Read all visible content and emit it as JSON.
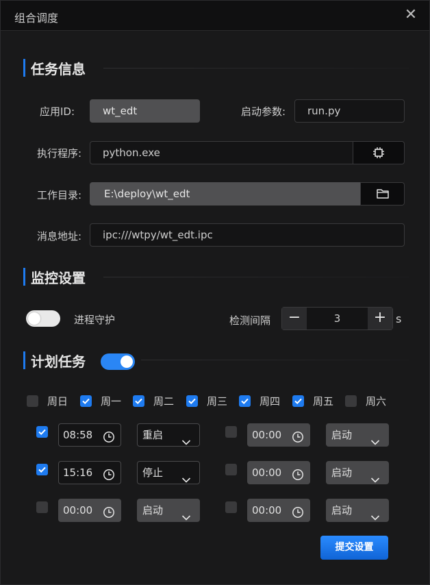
{
  "window": {
    "title": "组合调度",
    "close_icon": "close-icon"
  },
  "task_info": {
    "title": "任务信息",
    "app_id_label": "应用ID:",
    "app_id_value": "wt_edt",
    "start_params_label": "启动参数:",
    "start_params_value": "run.py",
    "exec_label": "执行程序:",
    "exec_value": "python.exe",
    "exec_icon": "chip-icon",
    "workdir_label": "工作目录:",
    "workdir_value": "E:\\deploy\\wt_edt",
    "workdir_icon": "folder-icon",
    "msg_addr_label": "消息地址:",
    "msg_addr_value": "ipc:///wtpy/wt_edt.ipc"
  },
  "monitor": {
    "title": "监控设置",
    "guard_label": "进程守护",
    "guard_on": false,
    "interval_label": "检测间隔",
    "interval_value": "3",
    "interval_unit": "s",
    "minus": "−",
    "plus": "+"
  },
  "schedule": {
    "title": "计划任务",
    "enabled": true,
    "days": [
      {
        "label": "周日",
        "checked": false
      },
      {
        "label": "周一",
        "checked": true
      },
      {
        "label": "周二",
        "checked": true
      },
      {
        "label": "周三",
        "checked": true
      },
      {
        "label": "周四",
        "checked": true
      },
      {
        "label": "周五",
        "checked": true
      },
      {
        "label": "周六",
        "checked": false
      }
    ],
    "slots": [
      {
        "checked": true,
        "time": "08:58",
        "action": "重启"
      },
      {
        "checked": false,
        "time": "00:00",
        "action": "启动"
      },
      {
        "checked": true,
        "time": "15:16",
        "action": "停止"
      },
      {
        "checked": false,
        "time": "00:00",
        "action": "启动"
      },
      {
        "checked": false,
        "time": "00:00",
        "action": "启动"
      },
      {
        "checked": false,
        "time": "00:00",
        "action": "启动"
      }
    ]
  },
  "submit_label": "提交设置",
  "colors": {
    "accent": "#1e7bf0",
    "background": "#19191a",
    "titlebar": "#101011"
  }
}
